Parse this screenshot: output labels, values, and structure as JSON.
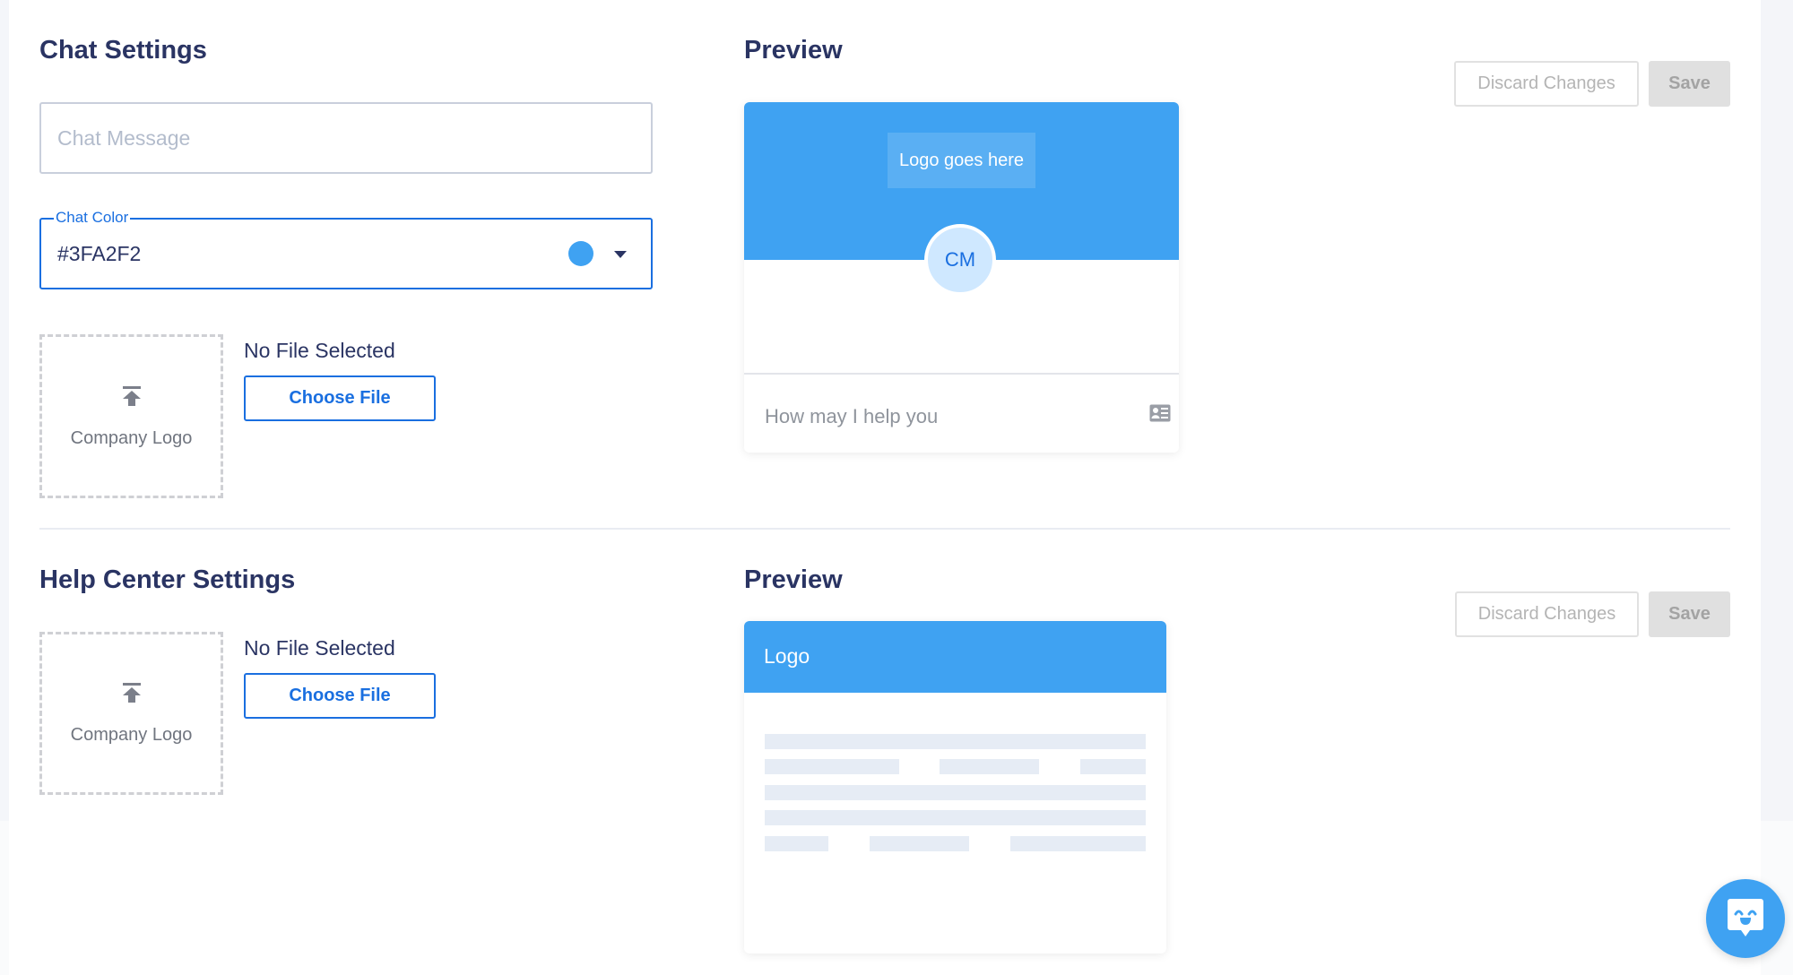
{
  "theme": {
    "accent": "#3FA2F2",
    "primary_text": "#2A3463",
    "link_blue": "#1A6FE0"
  },
  "chat_settings": {
    "title": "Chat Settings",
    "chat_message": {
      "placeholder": "Chat Message",
      "value": ""
    },
    "chat_color": {
      "label": "Chat Color",
      "value": "#3FA2F2",
      "swatch_color": "#3FA2F2",
      "dropdown_icon": "caret-down-icon"
    },
    "logo_upload": {
      "icon": "upload-icon",
      "label": "Company Logo",
      "file_status": "No File Selected",
      "choose_button": "Choose File"
    },
    "actions": {
      "discard": "Discard Changes",
      "save": "Save"
    },
    "preview": {
      "title": "Preview",
      "logo_placeholder": "Logo goes here",
      "avatar_initials": "CM",
      "input_placeholder": "How may I help you",
      "input_icon": "contact-card-icon"
    }
  },
  "help_center_settings": {
    "title": "Help Center Settings",
    "logo_upload": {
      "icon": "upload-icon",
      "label": "Company Logo",
      "file_status": "No File Selected",
      "choose_button": "Choose File"
    },
    "actions": {
      "discard": "Discard Changes",
      "save": "Save"
    },
    "preview": {
      "title": "Preview",
      "header_logo": "Logo"
    }
  },
  "chat_widget": {
    "icon": "smiling-chat-bubble-icon"
  }
}
